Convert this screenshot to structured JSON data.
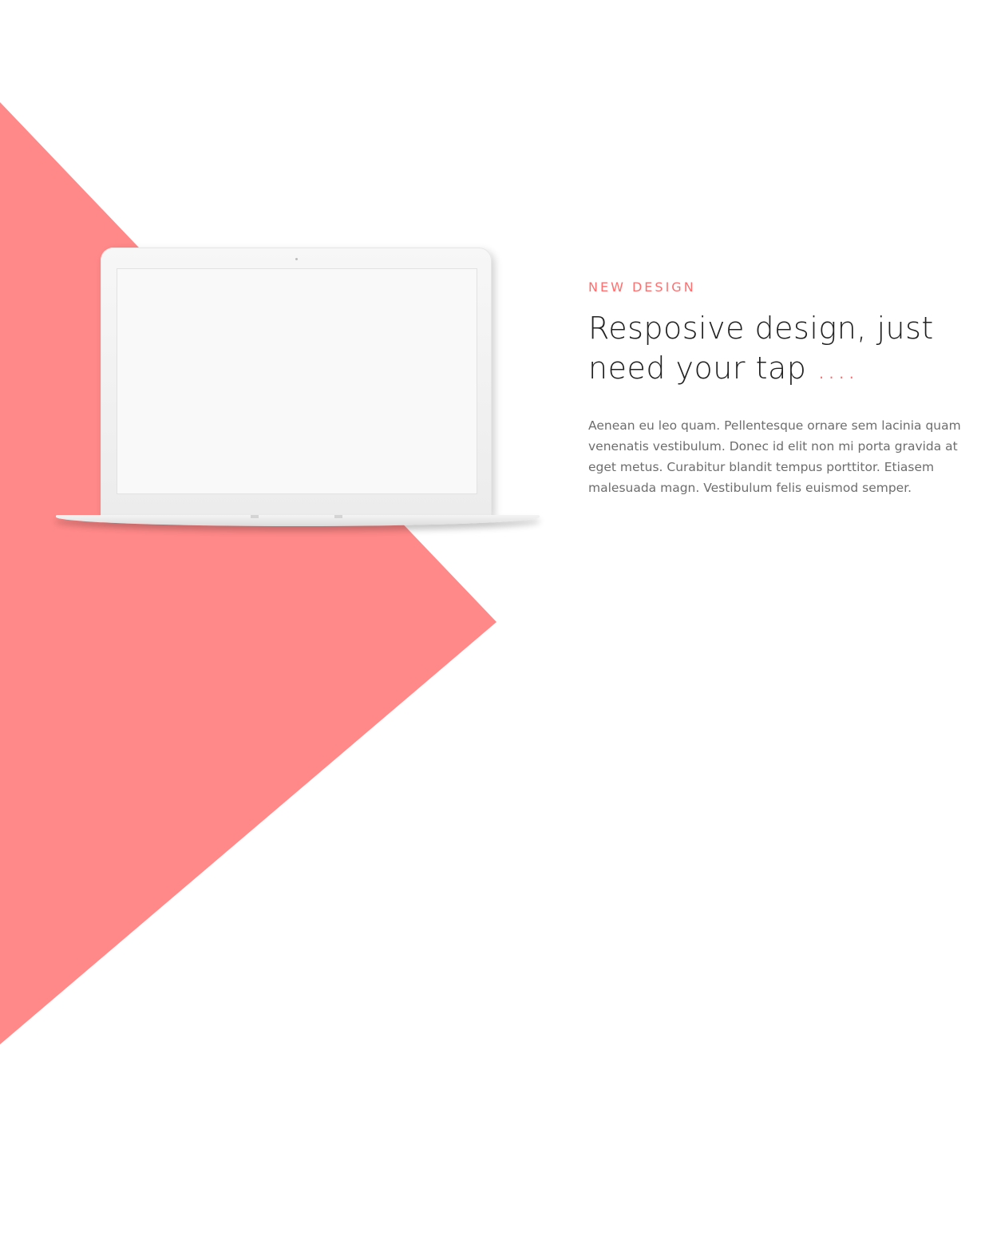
{
  "colors": {
    "accent": "#ff6f6f",
    "shape": "#ff8888",
    "headline": "#222222",
    "body": "#6d6d6d"
  },
  "feature": {
    "eyebrow": "NEW DESIGN",
    "headline_main": "Resposive design, just need your tap ",
    "headline_accent": "....",
    "body": "Aenean eu leo quam. Pellentesque ornare sem lacinia quam venenatis vestibulum. Donec id elit non mi porta gravida at eget metus. Curabitur blandit tempus porttitor. Etiasem malesuada magn. Vestibulum felis euismod semper."
  },
  "laptop": {
    "device": "laptop-mockup",
    "screen_content": "blank"
  }
}
